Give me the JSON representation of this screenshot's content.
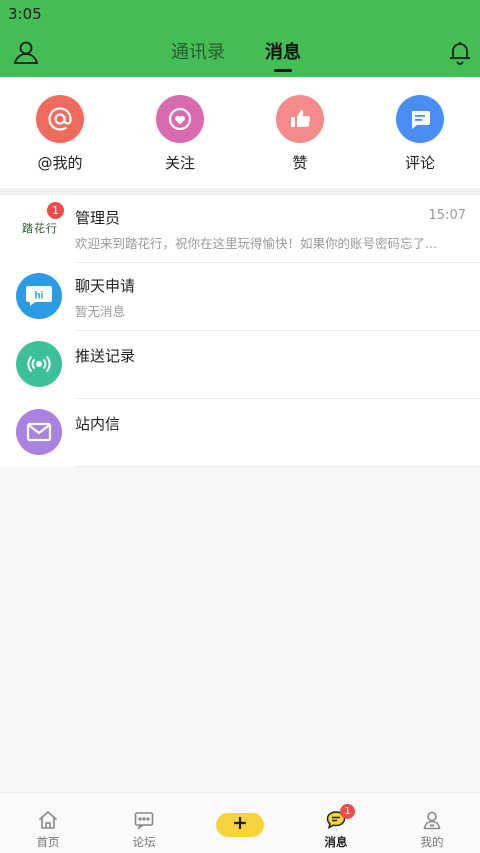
{
  "status_bar": {
    "time": "3:05"
  },
  "header": {
    "tabs": [
      {
        "label": "通讯录",
        "active": false
      },
      {
        "label": "消息",
        "active": true
      }
    ]
  },
  "colors": {
    "header_green": "#45bd55",
    "badge_red": "#f04b4b",
    "plus_yellow": "#f5d33c"
  },
  "shortcuts": [
    {
      "label": "@我的",
      "icon": "at-icon",
      "color": "#f06a5e"
    },
    {
      "label": "关注",
      "icon": "heart-icon",
      "color": "#d96ab0"
    },
    {
      "label": "赞",
      "icon": "thumbs-up-icon",
      "color": "#f58b8b"
    },
    {
      "label": "评论",
      "icon": "comment-icon",
      "color": "#4a8df5"
    }
  ],
  "messages": [
    {
      "title": "管理员",
      "time": "15:07",
      "preview": "欢迎来到踏花行，祝你在这里玩得愉快！如果你的账号密码忘了...",
      "badge": "1",
      "avatar_text": "踏花行",
      "icon": "logo"
    },
    {
      "title": "聊天申请",
      "preview": "暂无消息",
      "icon": "hi-icon",
      "color": "#2b9be6"
    },
    {
      "title": "推送记录",
      "icon": "broadcast-icon",
      "color": "#3dbf9a"
    },
    {
      "title": "站内信",
      "icon": "mail-icon",
      "color": "#a884e0"
    }
  ],
  "bottom_nav": {
    "items": [
      {
        "label": "首页",
        "icon": "home-icon"
      },
      {
        "label": "论坛",
        "icon": "forum-icon"
      },
      {
        "label": "",
        "icon": "plus-icon"
      },
      {
        "label": "消息",
        "icon": "message-icon",
        "active": true,
        "badge": "1"
      },
      {
        "label": "我的",
        "icon": "user-icon"
      }
    ]
  }
}
